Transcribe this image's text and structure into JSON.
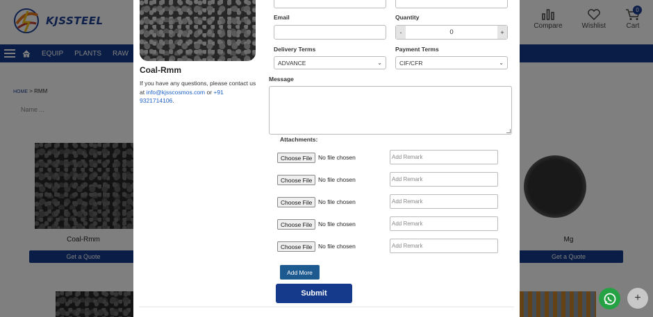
{
  "brand": {
    "name": "KJSSTEEL",
    "accent": "#153a8c"
  },
  "header": {
    "compare": "Compare",
    "wishlist": "Wishlist",
    "cart": "Cart",
    "cart_count": "0"
  },
  "nav": {
    "items": [
      "EQUIP",
      "PLANTS",
      "RAW"
    ]
  },
  "breadcrumb": {
    "home": "HOME",
    "sep": " > ",
    "current": "RMM"
  },
  "filter": {
    "name_placeholder": "Name ..."
  },
  "products": [
    {
      "title": "Coal-Rmm",
      "button": "Get a Quote"
    },
    {
      "title": "Mg",
      "button": "Get a Quote"
    }
  ],
  "modal": {
    "product_title": "Coal-Rmm",
    "help_text_pre": "If you have any questions, please contact us at ",
    "email": "info@kjsscosmos.com",
    "help_text_mid": " or ",
    "phone": "+91 9321714106",
    "help_text_end": ".",
    "email_label": "Email",
    "quantity_label": "Quantity",
    "quantity_minus": "-",
    "quantity_value": "0",
    "quantity_plus": "+",
    "delivery_label": "Delivery Terms",
    "delivery_value": "ADVANCE",
    "payment_label": "Payment Terms",
    "payment_value": "CIF/CFR",
    "message_label": "Message",
    "attachments_label": "Attachments:",
    "attachments": [
      {
        "button": "Choose File",
        "status": "No file chosen",
        "remark_placeholder": "Add Remark"
      },
      {
        "button": "Choose File",
        "status": "No file chosen",
        "remark_placeholder": "Add Remark"
      },
      {
        "button": "Choose File",
        "status": "No file chosen",
        "remark_placeholder": "Add Remark"
      },
      {
        "button": "Choose File",
        "status": "No file chosen",
        "remark_placeholder": "Add Remark"
      },
      {
        "button": "Choose File",
        "status": "No file chosen",
        "remark_placeholder": "Add Remark"
      }
    ],
    "add_more": "Add More",
    "submit": "Submit"
  }
}
